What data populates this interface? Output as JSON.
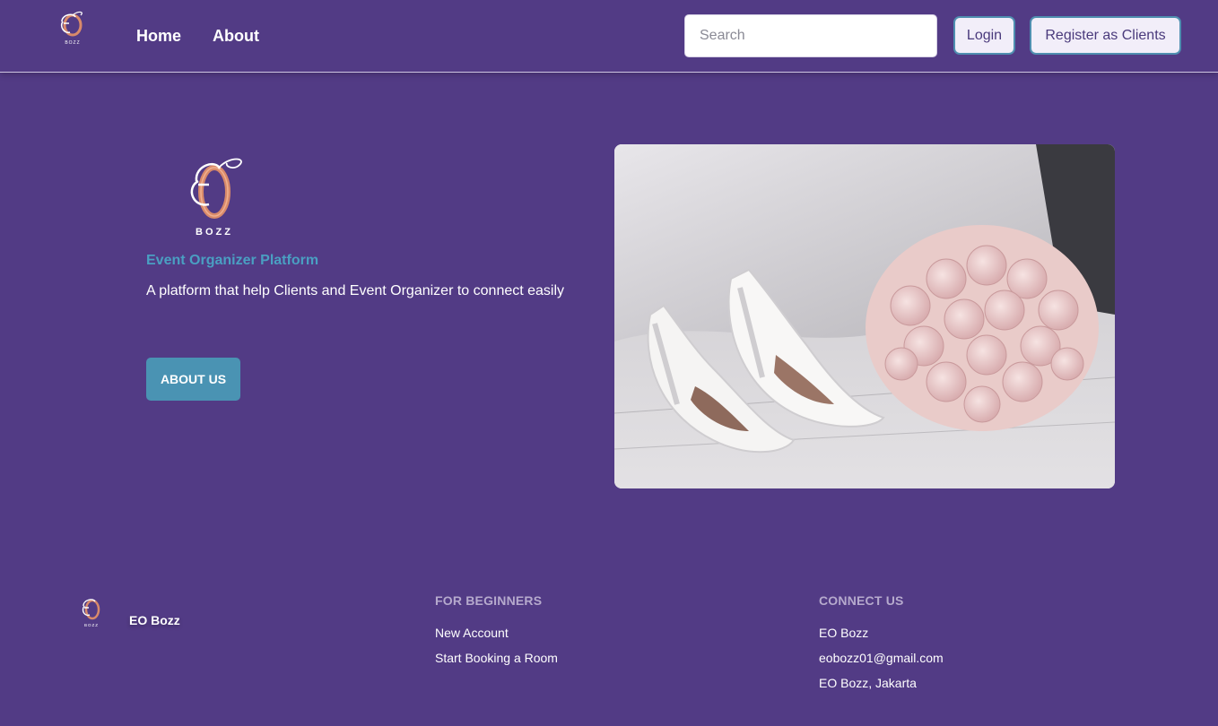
{
  "nav": {
    "logo_text": "BOZZ",
    "home_label": "Home",
    "about_label": "About",
    "search_placeholder": "Search",
    "login_label": "Login",
    "register_label": "Register as Clients"
  },
  "hero": {
    "logo_text": "BOZZ",
    "subtitle": "Event Organizer Platform",
    "description": "A platform that help Clients and Event Organizer to connect easily",
    "about_button": "ABOUT US",
    "image_icon": "wedding-shoes-bouquet-photo"
  },
  "footer": {
    "logo_text": "BOZZ",
    "brand": "EO Bozz",
    "beginners": {
      "heading": "FOR BEGINNERS",
      "links": [
        "New Account",
        "Start Booking a Room"
      ]
    },
    "connect": {
      "heading": "CONNECT US",
      "links": [
        "EO Bozz",
        "eobozz01@gmail.com",
        "EO Bozz, Jakarta"
      ]
    }
  },
  "colors": {
    "background": "#523b85",
    "accent": "#4a93b3",
    "subtitle": "#4a9fc2",
    "ring": "#d98a6a"
  }
}
